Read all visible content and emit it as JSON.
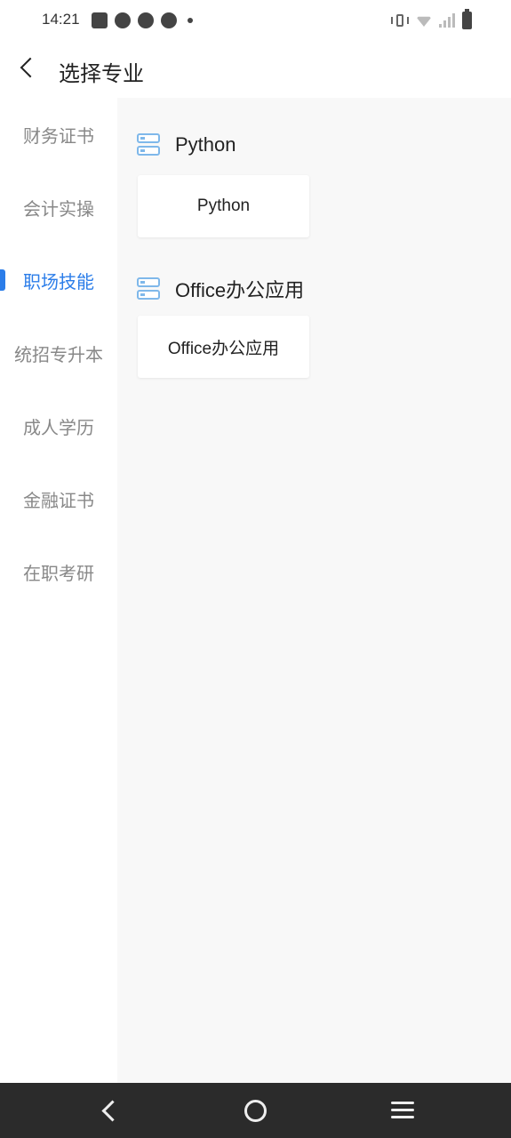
{
  "status_bar": {
    "time": "14:21"
  },
  "header": {
    "title": "选择专业"
  },
  "sidebar": {
    "items": [
      {
        "label": "财务证书",
        "active": false
      },
      {
        "label": "会计实操",
        "active": false
      },
      {
        "label": "职场技能",
        "active": true
      },
      {
        "label": "统招专升本",
        "active": false
      },
      {
        "label": "成人学历",
        "active": false
      },
      {
        "label": "金融证书",
        "active": false
      },
      {
        "label": "在职考研",
        "active": false
      }
    ]
  },
  "main": {
    "sections": [
      {
        "title": "Python",
        "icon": "database-icon",
        "cards": [
          "Python"
        ]
      },
      {
        "title": "Office办公应用",
        "icon": "database-icon",
        "cards": [
          "Office办公应用"
        ]
      }
    ]
  },
  "colors": {
    "accent": "#2b7de9",
    "icon": "#7fb8ea",
    "content_bg": "#f8f8f8",
    "navbar_bg": "#2b2b2b"
  }
}
